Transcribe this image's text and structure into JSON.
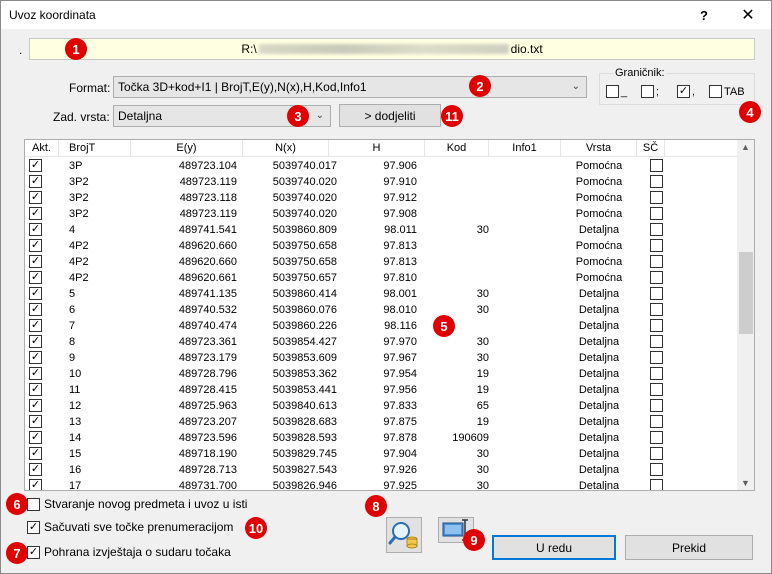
{
  "window": {
    "title": "Uvoz koordinata",
    "help_label": "?",
    "close_label": "✕"
  },
  "path": {
    "dot": ".",
    "prefix": "R:\\",
    "suffix": "dio.txt"
  },
  "format": {
    "label": "Format:",
    "value": "Točka 3D+kod+I1 | BrojT,E(y),N(x),H,Kod,Info1"
  },
  "zad_vrsta": {
    "label": "Zad. vrsta:",
    "value": "Detaljna"
  },
  "assign_button": {
    "label": "> dodjeliti"
  },
  "separator": {
    "title": "Graničnik:",
    "items": [
      {
        "symbol": "_",
        "checked": false
      },
      {
        "symbol": ";",
        "checked": false
      },
      {
        "symbol": ",",
        "checked": true
      },
      {
        "symbol": "TAB",
        "checked": false
      }
    ]
  },
  "table": {
    "columns": [
      "Akt.",
      "BrojT",
      "E(y)",
      "N(x)",
      "H",
      "Kod",
      "Info1",
      "Vrsta",
      "SČ"
    ],
    "rows": [
      [
        "3P",
        "489723.104",
        "5039740.017",
        "97.906",
        "",
        "",
        "Pomoćna"
      ],
      [
        "3P2",
        "489723.119",
        "5039740.020",
        "97.910",
        "",
        "",
        "Pomoćna"
      ],
      [
        "3P2",
        "489723.118",
        "5039740.020",
        "97.912",
        "",
        "",
        "Pomoćna"
      ],
      [
        "3P2",
        "489723.119",
        "5039740.020",
        "97.908",
        "",
        "",
        "Pomoćna"
      ],
      [
        "4",
        "489741.541",
        "5039860.809",
        "98.011",
        "30",
        "",
        "Detaljna"
      ],
      [
        "4P2",
        "489620.660",
        "5039750.658",
        "97.813",
        "",
        "",
        "Pomoćna"
      ],
      [
        "4P2",
        "489620.660",
        "5039750.658",
        "97.813",
        "",
        "",
        "Pomoćna"
      ],
      [
        "4P2",
        "489620.661",
        "5039750.657",
        "97.810",
        "",
        "",
        "Pomoćna"
      ],
      [
        "5",
        "489741.135",
        "5039860.414",
        "98.001",
        "30",
        "",
        "Detaljna"
      ],
      [
        "6",
        "489740.532",
        "5039860.076",
        "98.010",
        "30",
        "",
        "Detaljna"
      ],
      [
        "7",
        "489740.474",
        "5039860.226",
        "98.116",
        "",
        "",
        "Detaljna"
      ],
      [
        "8",
        "489723.361",
        "5039854.427",
        "97.970",
        "30",
        "",
        "Detaljna"
      ],
      [
        "9",
        "489723.179",
        "5039853.609",
        "97.967",
        "30",
        "",
        "Detaljna"
      ],
      [
        "10",
        "489728.796",
        "5039853.362",
        "97.954",
        "19",
        "",
        "Detaljna"
      ],
      [
        "11",
        "489728.415",
        "5039853.441",
        "97.956",
        "19",
        "",
        "Detaljna"
      ],
      [
        "12",
        "489725.963",
        "5039840.613",
        "97.833",
        "65",
        "",
        "Detaljna"
      ],
      [
        "13",
        "489723.207",
        "5039828.683",
        "97.875",
        "19",
        "",
        "Detaljna"
      ],
      [
        "14",
        "489723.596",
        "5039828.593",
        "97.878",
        "190609",
        "",
        "Detaljna"
      ],
      [
        "15",
        "489718.190",
        "5039829.745",
        "97.904",
        "30",
        "",
        "Detaljna"
      ],
      [
        "16",
        "489728.713",
        "5039827.543",
        "97.926",
        "30",
        "",
        "Detaljna"
      ],
      [
        "17",
        "489731.700",
        "5039826.946",
        "97.925",
        "30",
        "",
        "Detaljna"
      ]
    ]
  },
  "options": {
    "new_subject": {
      "label": "Stvaranje novog predmeta i uvoz u isti",
      "checked": false
    },
    "keep_points": {
      "label": "Sačuvati sve točke prenumeracijom",
      "checked": true
    },
    "save_report": {
      "label": "Pohrana izvještaja o sudaru točaka",
      "checked": true
    }
  },
  "buttons": {
    "ok": "U redu",
    "cancel": "Prekid"
  },
  "badges": [
    "1",
    "2",
    "3",
    "4",
    "5",
    "6",
    "7",
    "8",
    "9",
    "10",
    "11"
  ],
  "colors": {
    "badge": "#e00000",
    "path_bg": "#ffffe1",
    "focus": "#0078d7"
  }
}
